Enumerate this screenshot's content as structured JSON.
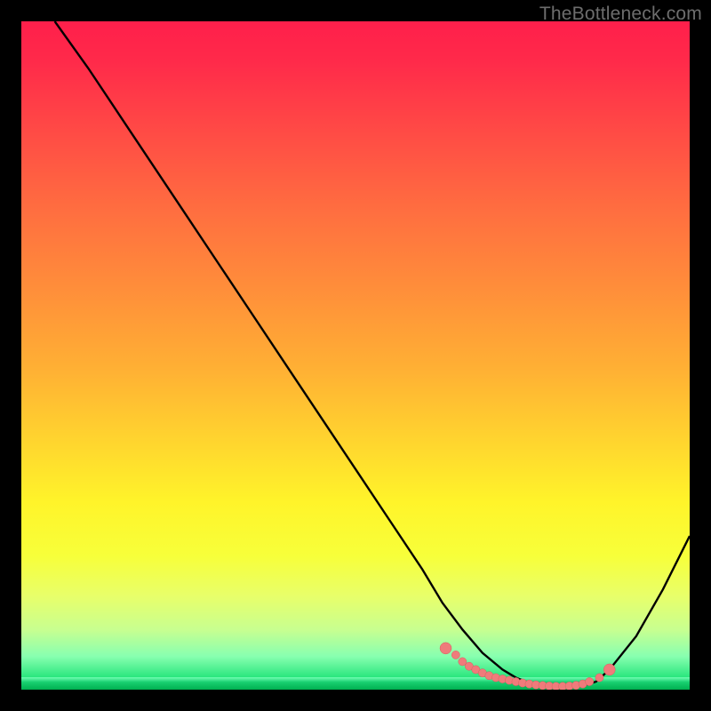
{
  "watermark": "TheBottleneck.com",
  "colors": {
    "curve_stroke": "#000000",
    "marker_fill": "#ef7b7b",
    "marker_stroke": "#d55f5f"
  },
  "chart_data": {
    "type": "line",
    "title": "",
    "xlabel": "",
    "ylabel": "",
    "xlim": [
      0,
      100
    ],
    "ylim": [
      0,
      100
    ],
    "series": [
      {
        "name": "bottleneck-curve",
        "x": [
          5,
          10,
          15,
          20,
          25,
          30,
          35,
          40,
          45,
          50,
          55,
          60,
          63,
          66,
          69,
          72,
          74,
          76,
          78,
          80,
          82,
          84,
          86,
          88,
          92,
          96,
          100
        ],
        "y": [
          100,
          93,
          85.5,
          78,
          70.5,
          63,
          55.5,
          48,
          40.5,
          33,
          25.5,
          18,
          13,
          9,
          5.5,
          3,
          1.8,
          1.0,
          0.6,
          0.4,
          0.4,
          0.6,
          1.2,
          3.0,
          8,
          15,
          23
        ]
      }
    ],
    "markers": {
      "name": "optimal-range",
      "x": [
        63.5,
        65,
        66,
        67,
        68,
        69,
        70,
        71,
        72,
        73,
        74,
        75,
        76,
        77,
        78,
        79,
        80,
        81,
        82,
        83,
        84,
        85,
        86.5,
        88
      ],
      "y": [
        6.2,
        5.2,
        4.2,
        3.5,
        3.0,
        2.5,
        2.1,
        1.8,
        1.6,
        1.4,
        1.2,
        1.0,
        0.85,
        0.72,
        0.62,
        0.55,
        0.5,
        0.5,
        0.55,
        0.65,
        0.85,
        1.2,
        1.8,
        3.0
      ]
    }
  }
}
